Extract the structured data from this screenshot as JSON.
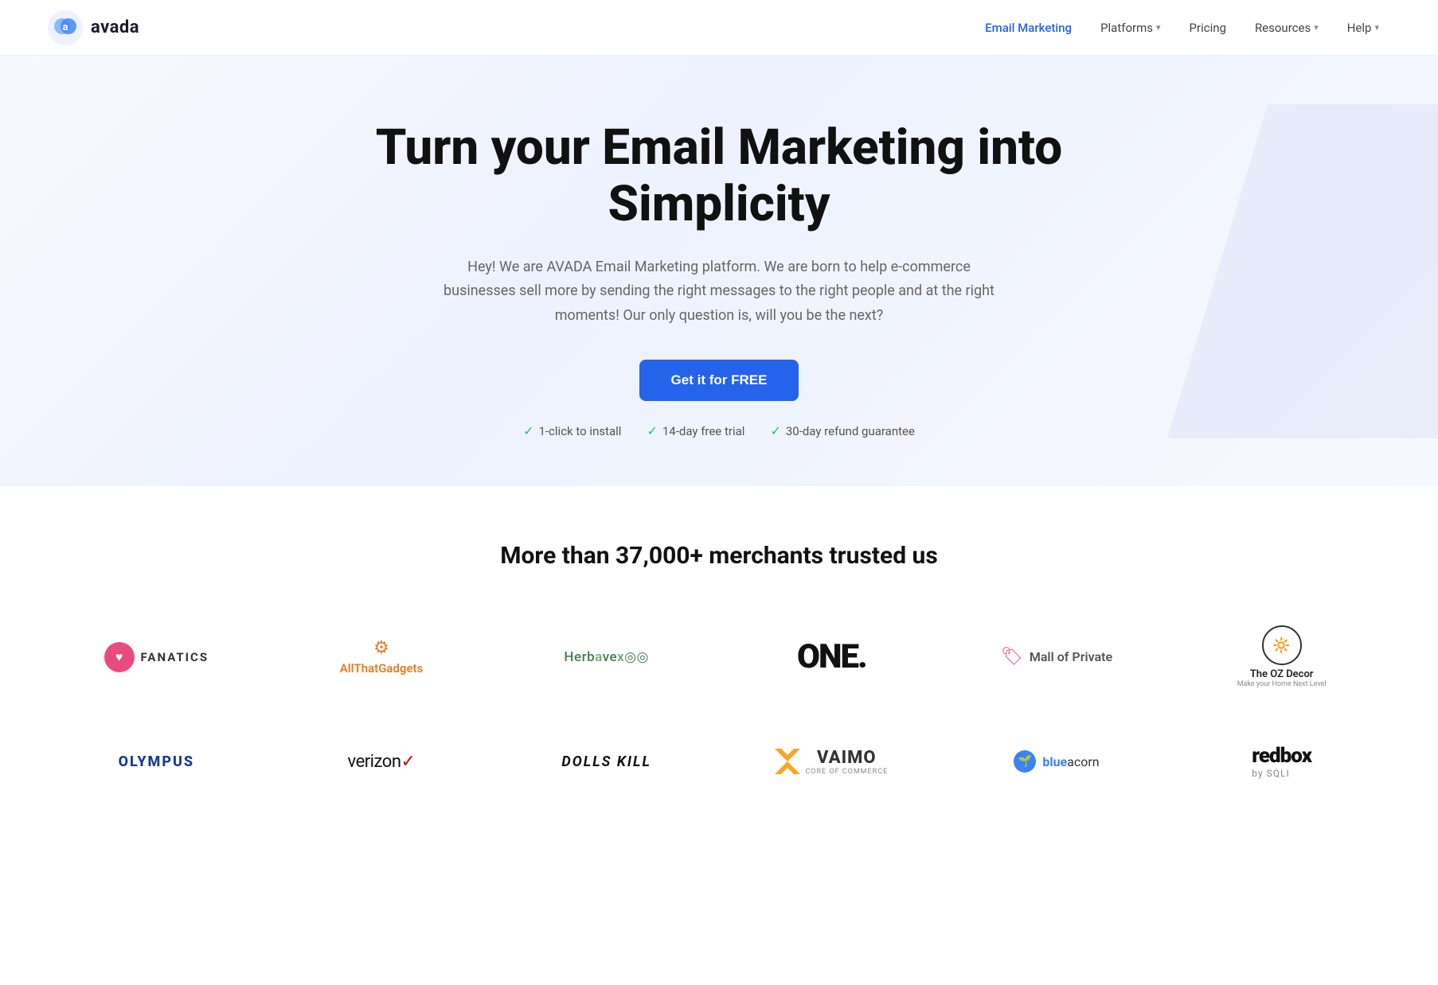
{
  "nav": {
    "logo_text": "avada",
    "links": [
      {
        "label": "Email Marketing",
        "active": true,
        "has_dropdown": false
      },
      {
        "label": "Platforms",
        "active": false,
        "has_dropdown": true
      },
      {
        "label": "Pricing",
        "active": false,
        "has_dropdown": false
      },
      {
        "label": "Resources",
        "active": false,
        "has_dropdown": true
      },
      {
        "label": "Help",
        "active": false,
        "has_dropdown": true
      }
    ]
  },
  "hero": {
    "title": "Turn your Email Marketing into Simplicity",
    "subtitle": "Hey! We are AVADA Email Marketing platform. We are born to help e-commerce businesses sell more by sending the right messages to the right people and at the right moments! Our only question is, will you be the next?",
    "cta_label": "Get it for FREE",
    "features": [
      {
        "text": "1-click to install"
      },
      {
        "text": "14-day free trial"
      },
      {
        "text": "30-day refund guarantee"
      }
    ]
  },
  "merchants": {
    "title": "More than 37,000+ merchants trusted us",
    "logos_row1": [
      {
        "id": "fanatics",
        "name": "Fanatics"
      },
      {
        "id": "allgadgets",
        "name": "AllThatGadgets"
      },
      {
        "id": "herbavex",
        "name": "Herbavex"
      },
      {
        "id": "one",
        "name": "ONE."
      },
      {
        "id": "mallprivate",
        "name": "Mall of Private"
      },
      {
        "id": "ozdecor",
        "name": "The OZ Decor"
      }
    ],
    "logos_row2": [
      {
        "id": "olympus",
        "name": "OLYMPUS"
      },
      {
        "id": "verizon",
        "name": "verizon"
      },
      {
        "id": "dollskill",
        "name": "DOLLS KILL"
      },
      {
        "id": "vaimo",
        "name": "VAIMO"
      },
      {
        "id": "blueacorn",
        "name": "blue acorn"
      },
      {
        "id": "redbox",
        "name": "redbox by SQLI"
      }
    ]
  }
}
